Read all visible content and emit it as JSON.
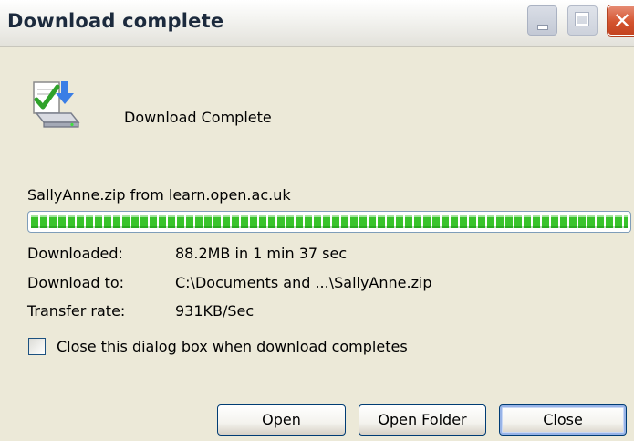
{
  "window": {
    "title": "Download complete",
    "controls": {
      "minimize_icon": "minimize-icon",
      "maximize_icon": "maximize-icon",
      "close_icon": "close-icon"
    },
    "colors": {
      "face": "#ece9d8",
      "close_red": "#d4542f",
      "progress_green": "#39c32c",
      "button_border": "#003c74"
    }
  },
  "header": {
    "icon": "download-complete-icon",
    "heading": "Download Complete"
  },
  "download": {
    "source": "SallyAnne.zip from learn.open.ac.uk",
    "progress": 1.0,
    "details": [
      {
        "label": "Downloaded:",
        "value": "88.2MB in 1 min 37 sec"
      },
      {
        "label": "Download to:",
        "value": "C:\\Documents and ...\\SallyAnne.zip"
      },
      {
        "label": "Transfer rate:",
        "value": "931KB/Sec"
      }
    ]
  },
  "options": {
    "close_on_complete_label": "Close this dialog box when download completes",
    "close_on_complete_checked": false
  },
  "buttons": {
    "open": "Open",
    "open_folder": "Open Folder",
    "close": "Close"
  }
}
